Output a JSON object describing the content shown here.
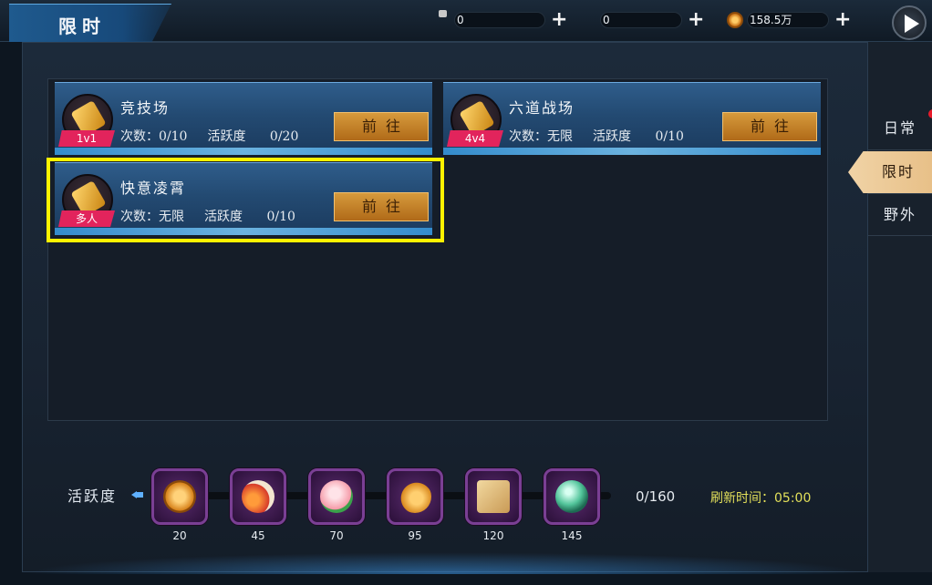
{
  "header": {
    "title": "限时"
  },
  "resources": [
    {
      "name": "bound-ingot",
      "value": "0",
      "icon": "locked-ingot-icon"
    },
    {
      "name": "ingot",
      "value": "0",
      "icon": "ingot-icon"
    },
    {
      "name": "copper",
      "value": "158.5万",
      "icon": "coin-icon"
    }
  ],
  "activities": [
    {
      "name": "竞技场",
      "tag": "1v1",
      "count_label": "次数：0/10",
      "active_label": "活跃度",
      "active_value": "0/20",
      "go_label": "前往"
    },
    {
      "name": "六道战场",
      "tag": "4v4",
      "count_label": "次数：无限",
      "active_label": "活跃度",
      "active_value": "0/10",
      "go_label": "前往"
    },
    {
      "name": "快意凌霄",
      "tag": "多人",
      "count_label": "次数：无限",
      "active_label": "活跃度",
      "active_value": "0/10",
      "go_label": "前往"
    }
  ],
  "side_tabs": [
    {
      "label": "日常"
    },
    {
      "label": "限时"
    },
    {
      "label": "野外"
    }
  ],
  "activity_bar": {
    "label": "活跃度",
    "progress_text": "0/160",
    "refresh_text": "刷新时间：05:00",
    "rewards": [
      {
        "value": "20",
        "icon": "copper-coin-icon"
      },
      {
        "value": "45",
        "icon": "gourd-icon"
      },
      {
        "value": "70",
        "icon": "peach-icon"
      },
      {
        "value": "95",
        "icon": "locked-ingot-icon"
      },
      {
        "value": "120",
        "icon": "treasure-map-icon"
      },
      {
        "value": "145",
        "icon": "jade-orb-icon"
      }
    ]
  },
  "colors": {
    "accent": "#fff200",
    "button": "#c98126",
    "tag": "#e2245c",
    "refresh": "#e3e05a"
  }
}
